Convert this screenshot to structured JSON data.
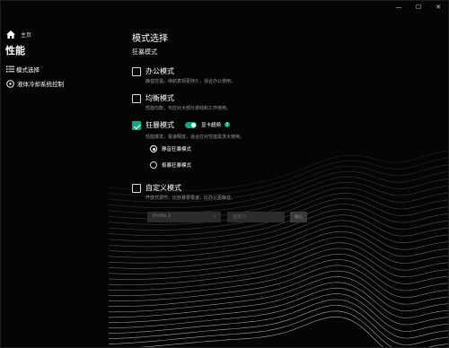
{
  "window": {
    "controls": [
      "—",
      "☐",
      "✕"
    ]
  },
  "sidebar": {
    "home_label": "主页",
    "section_title": "性能",
    "items": [
      {
        "label": "模式选择",
        "icon": "list-icon"
      },
      {
        "label": "液体冷却系统控制",
        "icon": "cooling-icon"
      }
    ]
  },
  "main": {
    "title": "模式选择",
    "subtitle": "狂暴模式",
    "options": [
      {
        "label": "办公模式",
        "desc": "静音控温，续航表现更持久，适合办公使用。",
        "checked": false
      },
      {
        "label": "均衡模式",
        "desc": "性能均衡，可应对大部分游戏和工作使用。",
        "checked": false
      },
      {
        "label": "狂暴模式",
        "desc": "性能爆发，极速释放，适合应对性能需求大使用。",
        "checked": true,
        "toggle_label": "显卡超频",
        "toggle_on": true,
        "radios": [
          {
            "label": "静音狂暴模式",
            "selected": true
          },
          {
            "label": "极暴狂暴模式",
            "selected": false
          }
        ]
      },
      {
        "label": "自定义模式",
        "desc": "开放式调节，比狂暴更极速，比办公更静音。",
        "checked": false
      }
    ],
    "custom": {
      "profile_value": "Profile 1",
      "name_placeholder": "自定义",
      "confirm_label": "确认"
    }
  },
  "colors": {
    "accent": "#17a37f",
    "background": "#050505"
  }
}
